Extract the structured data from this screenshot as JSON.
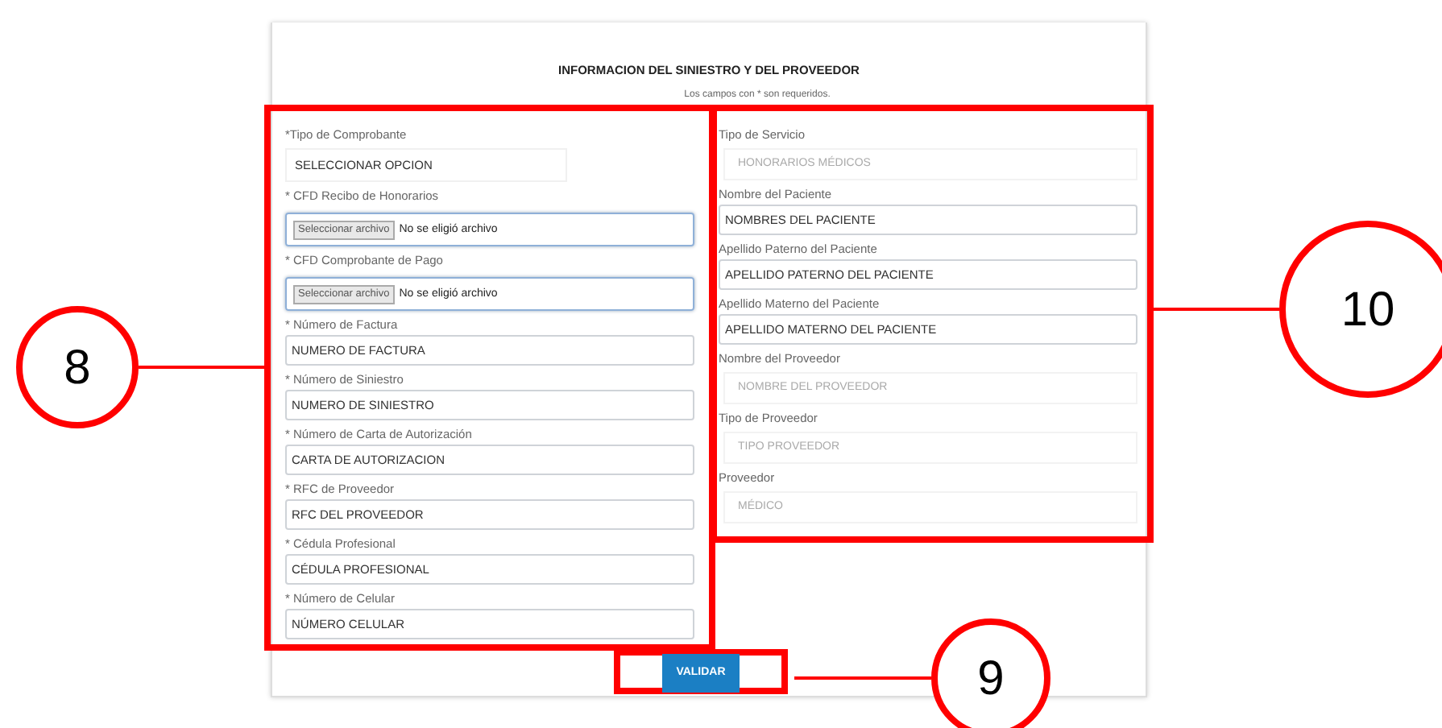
{
  "title": "INFORMACION DEL SINIESTRO Y DEL PROVEEDOR",
  "subtitle": "Los campos con * son requeridos.",
  "left_fields": [
    {
      "label": "*Tipo de Comprobante",
      "kind": "select",
      "value": "SELECCIONAR OPCION"
    },
    {
      "label": "* CFD Recibo de Honorarios",
      "kind": "file",
      "button": "Seleccionar archivo",
      "status": "No se eligió archivo"
    },
    {
      "label": "* CFD Comprobante de Pago",
      "kind": "file",
      "button": "Seleccionar archivo",
      "status": "No se eligió archivo"
    },
    {
      "label": "* Número de Factura",
      "kind": "text",
      "value": "NUMERO DE FACTURA"
    },
    {
      "label": "* Número de Siniestro",
      "kind": "text",
      "value": "NUMERO DE SINIESTRO"
    },
    {
      "label": "* Número de Carta de Autorización",
      "kind": "text",
      "value": "CARTA DE AUTORIZACION"
    },
    {
      "label": "* RFC de Proveedor",
      "kind": "text",
      "value": "RFC DEL PROVEEDOR"
    },
    {
      "label": "* Cédula Profesional",
      "kind": "text",
      "value": "CÉDULA PROFESIONAL"
    },
    {
      "label": "* Número de Celular",
      "kind": "text",
      "value": "NÚMERO CELULAR"
    }
  ],
  "right_fields": [
    {
      "label": "Tipo de Servicio",
      "kind": "readonly",
      "value": "HONORARIOS MÉDICOS"
    },
    {
      "label": "Nombre del Paciente",
      "kind": "text",
      "value": "NOMBRES DEL PACIENTE"
    },
    {
      "label": "Apellido Paterno del Paciente",
      "kind": "text",
      "value": "APELLIDO PATERNO DEL PACIENTE"
    },
    {
      "label": "Apellido Materno del Paciente",
      "kind": "text",
      "value": "APELLIDO MATERNO DEL PACIENTE"
    },
    {
      "label": "Nombre del Proveedor",
      "kind": "readonly",
      "value": "NOMBRE DEL PROVEEDOR"
    },
    {
      "label": "Tipo de Proveedor",
      "kind": "readonly",
      "value": "TIPO PROVEEDOR"
    },
    {
      "label": "Proveedor",
      "kind": "readonly",
      "value": "MÉDICO"
    }
  ],
  "button": "VALIDAR",
  "callouts": [
    "8",
    "9",
    "10"
  ]
}
